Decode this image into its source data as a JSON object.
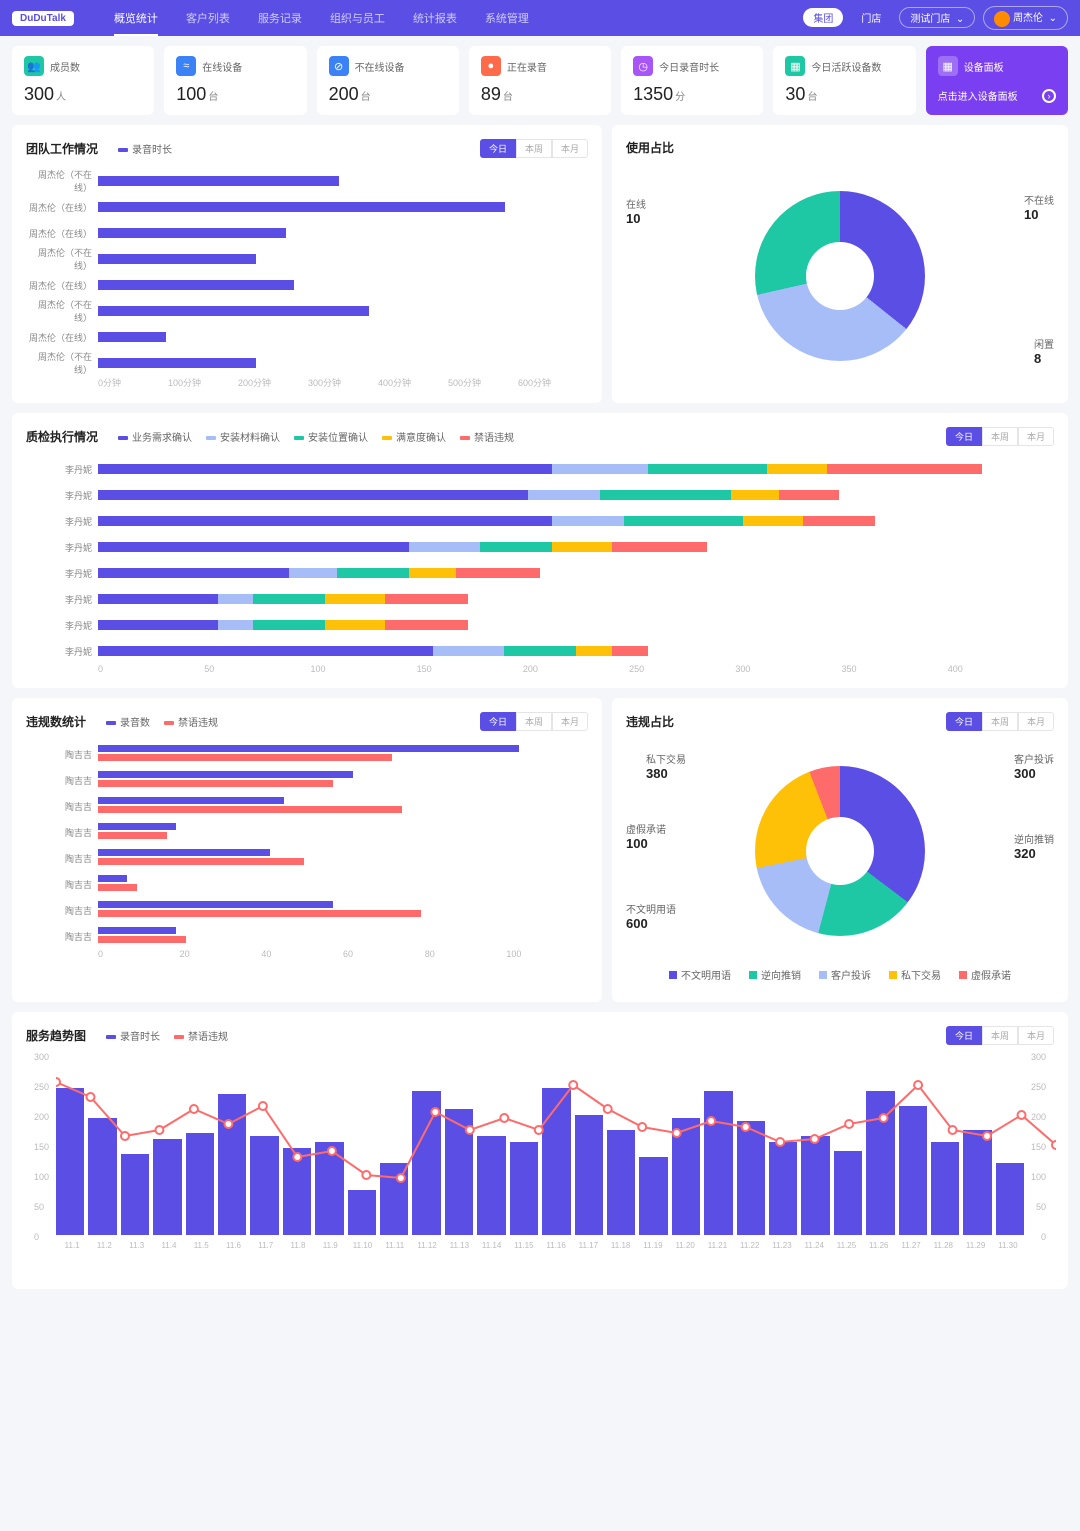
{
  "nav": {
    "logo": "DuDuTalk",
    "items": [
      "概览统计",
      "客户列表",
      "服务记录",
      "组织与员工",
      "统计报表",
      "系统管理"
    ],
    "active": 0,
    "right": {
      "grp": "集团",
      "store": "门店",
      "test": "测试门店",
      "user": "周杰伦"
    }
  },
  "stats": [
    {
      "icon": "👥",
      "color": "#1ec8a5",
      "label": "成员数",
      "value": "300",
      "unit": "人"
    },
    {
      "icon": "≈",
      "color": "#3b82f6",
      "label": "在线设备",
      "value": "100",
      "unit": "台"
    },
    {
      "icon": "⊘",
      "color": "#3b82f6",
      "label": "不在线设备",
      "value": "200",
      "unit": "台"
    },
    {
      "icon": "●",
      "color": "#ff6b4a",
      "label": "正在录音",
      "value": "89",
      "unit": "台"
    },
    {
      "icon": "◷",
      "color": "#a855f7",
      "label": "今日录音时长",
      "value": "1350",
      "unit": "分"
    },
    {
      "icon": "▦",
      "color": "#1ec8a5",
      "label": "今日活跃设备数",
      "value": "30",
      "unit": "台"
    },
    {
      "icon": "▦",
      "color": "#fff",
      "label": "设备面板",
      "sub": "点击进入设备面板",
      "purple": true
    }
  ],
  "chart_data": [
    {
      "id": "team",
      "title": "团队工作情况",
      "type": "bar",
      "orientation": "h",
      "legend": [
        {
          "name": "录音时长",
          "color": "#5b4ee5"
        }
      ],
      "tabs": [
        "今日",
        "本周",
        "本月"
      ],
      "active_tab": 0,
      "xlabel": "分钟",
      "xticks": [
        "0分钟",
        "100分钟",
        "200分钟",
        "300分钟",
        "400分钟",
        "500分钟",
        "600分钟"
      ],
      "xlim": [
        0,
        650
      ],
      "categories": [
        "周杰伦（不在线）",
        "周杰伦（在线）",
        "周杰伦（在线）",
        "周杰伦（不在线）",
        "周杰伦（在线）",
        "周杰伦（不在线）",
        "周杰伦（在线）",
        "周杰伦（不在线）"
      ],
      "values": [
        320,
        540,
        250,
        210,
        260,
        360,
        90,
        210
      ]
    },
    {
      "id": "usage",
      "title": "使用占比",
      "type": "pie",
      "series": [
        {
          "name": "在线",
          "value": 10,
          "color": "#5b4ee5"
        },
        {
          "name": "不在线",
          "value": 10,
          "color": "#a7bdf7"
        },
        {
          "name": "闲置",
          "value": 8,
          "color": "#1ec8a5"
        }
      ]
    },
    {
      "id": "qc",
      "title": "质检执行情况",
      "type": "bar",
      "orientation": "h",
      "stacked": true,
      "tabs": [
        "今日",
        "本周",
        "本月"
      ],
      "active_tab": 0,
      "legend": [
        {
          "name": "业务需求确认",
          "color": "#5b4ee5"
        },
        {
          "name": "安装材料确认",
          "color": "#a7bdf7"
        },
        {
          "name": "安装位置确认",
          "color": "#1ec8a5"
        },
        {
          "name": "满意度确认",
          "color": "#ffc107"
        },
        {
          "name": "禁语违规",
          "color": "#ff6b6b"
        }
      ],
      "xticks": [
        "0",
        "50",
        "100",
        "150",
        "200",
        "250",
        "300",
        "350",
        "400"
      ],
      "xlim": [
        0,
        400
      ],
      "categories": [
        "李丹妮",
        "李丹妮",
        "李丹妮",
        "李丹妮",
        "李丹妮",
        "李丹妮",
        "李丹妮",
        "李丹妮"
      ],
      "series": [
        {
          "name": "业务需求确认",
          "values": [
            190,
            180,
            190,
            130,
            80,
            50,
            50,
            140
          ]
        },
        {
          "name": "安装材料确认",
          "values": [
            40,
            30,
            30,
            30,
            20,
            15,
            15,
            30
          ]
        },
        {
          "name": "安装位置确认",
          "values": [
            50,
            55,
            50,
            30,
            30,
            30,
            30,
            30
          ]
        },
        {
          "name": "满意度确认",
          "values": [
            25,
            20,
            25,
            25,
            20,
            25,
            25,
            15
          ]
        },
        {
          "name": "禁语违规",
          "values": [
            65,
            25,
            30,
            40,
            35,
            35,
            35,
            15
          ]
        }
      ]
    },
    {
      "id": "viol_count",
      "title": "违规数统计",
      "type": "bar",
      "orientation": "h",
      "tabs": [
        "今日",
        "本周",
        "本月"
      ],
      "active_tab": 0,
      "legend": [
        {
          "name": "录音数",
          "color": "#5b4ee5"
        },
        {
          "name": "禁语违规",
          "color": "#ff6b6b"
        }
      ],
      "xticks": [
        "0",
        "20",
        "40",
        "60",
        "80",
        "100"
      ],
      "xlim": [
        0,
        100
      ],
      "categories": [
        "陶吉吉",
        "陶吉吉",
        "陶吉吉",
        "陶吉吉",
        "陶吉吉",
        "陶吉吉",
        "陶吉吉",
        "陶吉吉"
      ],
      "series": [
        {
          "name": "录音数",
          "values": [
            86,
            52,
            38,
            16,
            35,
            6,
            48,
            16
          ]
        },
        {
          "name": "禁语违规",
          "values": [
            60,
            48,
            62,
            14,
            42,
            8,
            66,
            18
          ]
        }
      ]
    },
    {
      "id": "viol_ratio",
      "title": "违规占比",
      "type": "pie",
      "tabs": [
        "今日",
        "本周",
        "本月"
      ],
      "active_tab": 0,
      "series": [
        {
          "name": "不文明用语",
          "value": 600,
          "color": "#5b4ee5"
        },
        {
          "name": "逆向推销",
          "value": 320,
          "color": "#1ec8a5"
        },
        {
          "name": "客户投诉",
          "value": 300,
          "color": "#a7bdf7"
        },
        {
          "name": "私下交易",
          "value": 380,
          "color": "#ffc107"
        },
        {
          "name": "虚假承诺",
          "value": 100,
          "color": "#ff6b6b"
        }
      ]
    },
    {
      "id": "trend",
      "title": "服务趋势图",
      "type": "bar+line",
      "tabs": [
        "今日",
        "本周",
        "本月"
      ],
      "active_tab": 0,
      "legend": [
        {
          "name": "录音时长",
          "color": "#5b4ee5"
        },
        {
          "name": "禁语违规",
          "color": "#ff6b6b",
          "shape": "line"
        }
      ],
      "yticks": [
        0,
        50,
        100,
        150,
        200,
        250,
        300
      ],
      "ylim": [
        0,
        300
      ],
      "categories": [
        "11.1",
        "11.2",
        "11.3",
        "11.4",
        "11.5",
        "11.6",
        "11.7",
        "11.8",
        "11.9",
        "11.10",
        "11.11",
        "11.12",
        "11.13",
        "11.14",
        "11.15",
        "11.16",
        "11.17",
        "11.18",
        "11.19",
        "11.20",
        "11.21",
        "11.22",
        "11.23",
        "11.24",
        "11.25",
        "11.26",
        "11.27",
        "11.28",
        "11.29",
        "11.30"
      ],
      "series": [
        {
          "name": "录音时长",
          "type": "bar",
          "values": [
            245,
            195,
            135,
            160,
            170,
            235,
            165,
            145,
            155,
            75,
            120,
            240,
            210,
            165,
            155,
            245,
            200,
            175,
            130,
            195,
            240,
            190,
            155,
            165,
            140,
            240,
            215,
            155,
            175,
            120
          ]
        },
        {
          "name": "禁语违规",
          "type": "line",
          "values": [
            255,
            230,
            165,
            175,
            210,
            185,
            215,
            130,
            140,
            100,
            95,
            205,
            175,
            195,
            175,
            250,
            210,
            180,
            170,
            190,
            180,
            155,
            160,
            185,
            195,
            250,
            175,
            165,
            200,
            150
          ]
        }
      ]
    }
  ]
}
